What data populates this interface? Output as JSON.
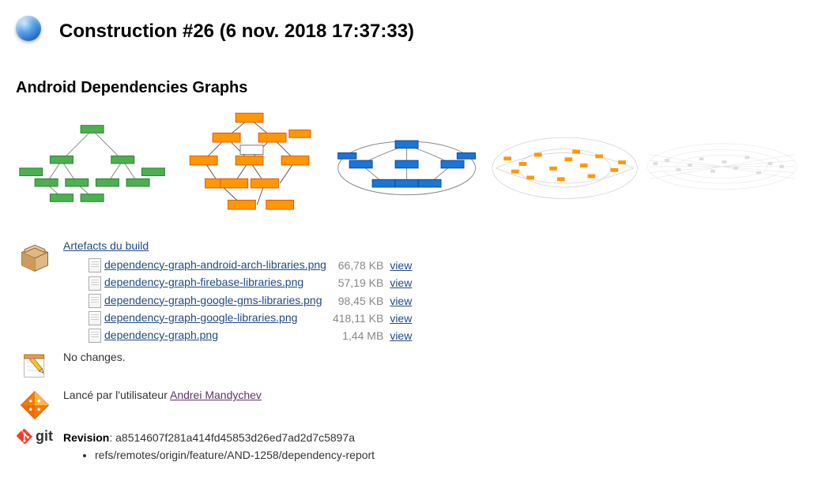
{
  "header": {
    "title": "Construction #26 (6 nov. 2018 17:37:33)"
  },
  "graphs": {
    "title": "Android Dependencies Graphs"
  },
  "artefacts": {
    "title": "Artefacts du build",
    "view_label": "view",
    "files": [
      {
        "name": "dependency-graph-android-arch-libraries.png",
        "size": "66,78 KB"
      },
      {
        "name": "dependency-graph-firebase-libraries.png",
        "size": "57,19 KB"
      },
      {
        "name": "dependency-graph-google-gms-libraries.png",
        "size": "98,45 KB"
      },
      {
        "name": "dependency-graph-google-libraries.png",
        "size": "418,11 KB"
      },
      {
        "name": "dependency-graph.png",
        "size": "1,44 MB"
      }
    ]
  },
  "changes": {
    "text": "No changes."
  },
  "cause": {
    "prefix": "Lancé par l'utilisateur ",
    "user": "Andrei Mandychev"
  },
  "revision": {
    "label": "Revision",
    "value": "a8514607f281a414fd45853d26ed7ad2d7c5897a",
    "refs": [
      "refs/remotes/origin/feature/AND-1258/dependency-report"
    ]
  }
}
